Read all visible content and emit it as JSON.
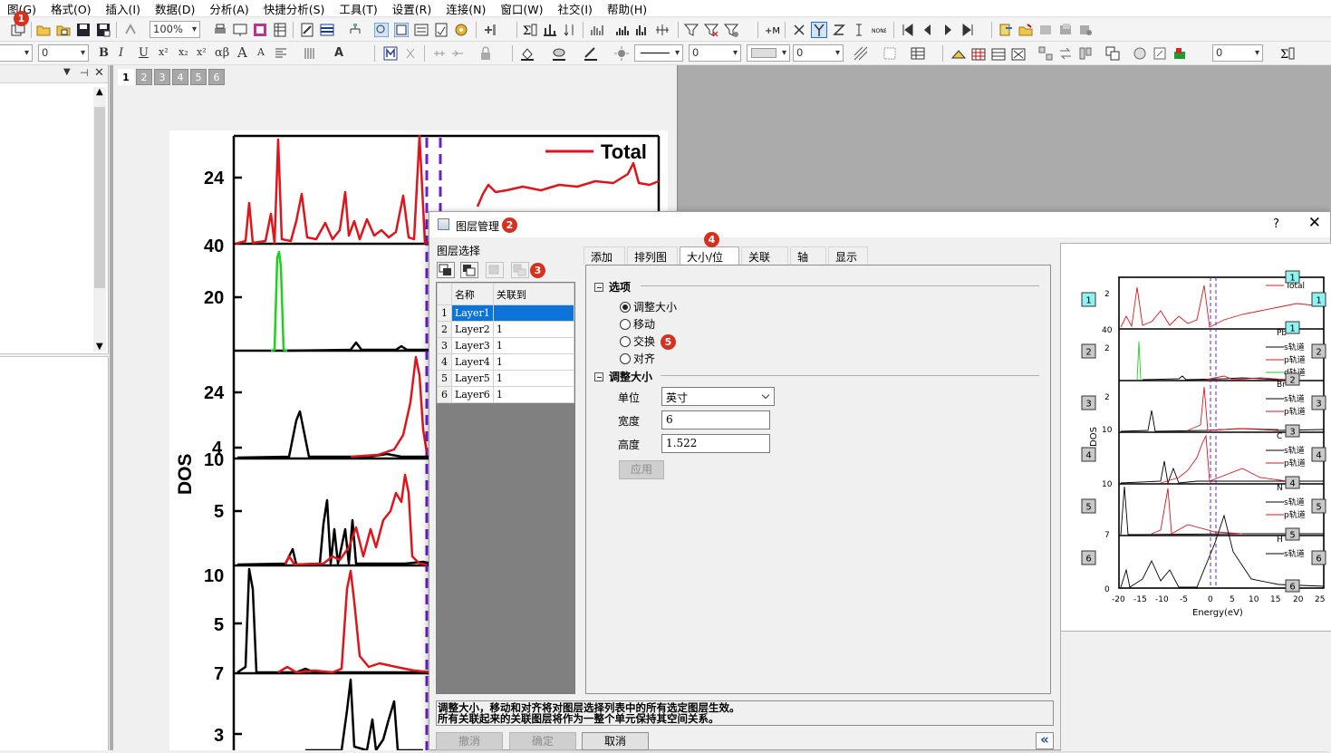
{
  "menubar": {
    "items": [
      "图(G)",
      "格式(O)",
      "插入(I)",
      "数据(D)",
      "分析(A)",
      "快捷分析(S)",
      "工具(T)",
      "设置(R)",
      "连接(N)",
      "窗口(W)",
      "社交(I)",
      "帮助(H)"
    ]
  },
  "annotations": {
    "m1": "1",
    "m2": "2",
    "m3": "3",
    "m4": "4",
    "m5": "5"
  },
  "toolbar1": {
    "zoom": "100%"
  },
  "toolbar2": {
    "font_size": "0",
    "bold": "B",
    "italic": "I",
    "underline": "U",
    "superscript": "x²",
    "subscript": "x₂",
    "greek": "αβ",
    "line_width": "0",
    "font_size2": "0",
    "layer_count": "0"
  },
  "page_tabs": [
    "1",
    "2",
    "3",
    "4",
    "5",
    "6"
  ],
  "graph": {
    "legend": "Total",
    "y_label": "DOS",
    "panels": [
      {
        "ticks": [
          "24"
        ]
      },
      {
        "ticks": [
          "40",
          "20"
        ]
      },
      {
        "ticks": [
          "24",
          "4"
        ]
      },
      {
        "ticks": [
          "10",
          "5"
        ]
      },
      {
        "ticks": [
          "10",
          "5"
        ]
      },
      {
        "ticks": [
          "7",
          "3"
        ]
      }
    ]
  },
  "dialog": {
    "title": "图层管理",
    "help": "?",
    "close": "✕",
    "layer_select_label": "图层选择",
    "table": {
      "headers": [
        "名称",
        "关联到"
      ],
      "rows": [
        {
          "num": "1",
          "name": "Layer1",
          "link": ""
        },
        {
          "num": "2",
          "name": "Layer2",
          "link": "1"
        },
        {
          "num": "3",
          "name": "Layer3",
          "link": "1"
        },
        {
          "num": "4",
          "name": "Layer4",
          "link": "1"
        },
        {
          "num": "5",
          "name": "Layer5",
          "link": "1"
        },
        {
          "num": "6",
          "name": "Layer6",
          "link": "1"
        }
      ]
    },
    "tabs": [
      "添加",
      "排列图层",
      "大小/位置",
      "关联",
      "轴",
      "显示"
    ],
    "active_tab": "大小/位置",
    "options_title": "选项",
    "radios": [
      {
        "label": "调整大小",
        "checked": true
      },
      {
        "label": "移动",
        "checked": false
      },
      {
        "label": "交换",
        "checked": false
      },
      {
        "label": "对齐",
        "checked": false
      }
    ],
    "resize_title": "调整大小",
    "unit_label": "单位",
    "unit_value": "英寸",
    "width_label": "宽度",
    "width_value": "6",
    "height_label": "高度",
    "height_value": "1.522",
    "apply_label": "应用",
    "description_line1": "调整大小，移动和对齐将对图层选择列表中的所有选定图层生效。",
    "description_line2": "所有关联起来的关联图层将作为一整个单元保持其空间关系。",
    "undo_label": "撤消",
    "ok_label": "确定",
    "cancel_label": "取消",
    "collapse_label": "«"
  },
  "preview": {
    "x_label": "Energy(eV)",
    "y_label": "DOS",
    "x_ticks": [
      "-20",
      "-15",
      "-10",
      "-5",
      "0",
      "5",
      "10",
      "15",
      "20",
      "25"
    ],
    "legend_total": "Total",
    "legend_s": "s轨道",
    "legend_p": "p轨道",
    "legend_d": "d轨道",
    "element_labels": [
      "Pb",
      "Br",
      "C",
      "N",
      "H"
    ],
    "y_ticks": [
      "2",
      "40",
      "2",
      "2",
      "10",
      "10",
      "7",
      "0"
    ],
    "layer_numbers": [
      "1",
      "2",
      "3",
      "4",
      "5",
      "6"
    ]
  }
}
